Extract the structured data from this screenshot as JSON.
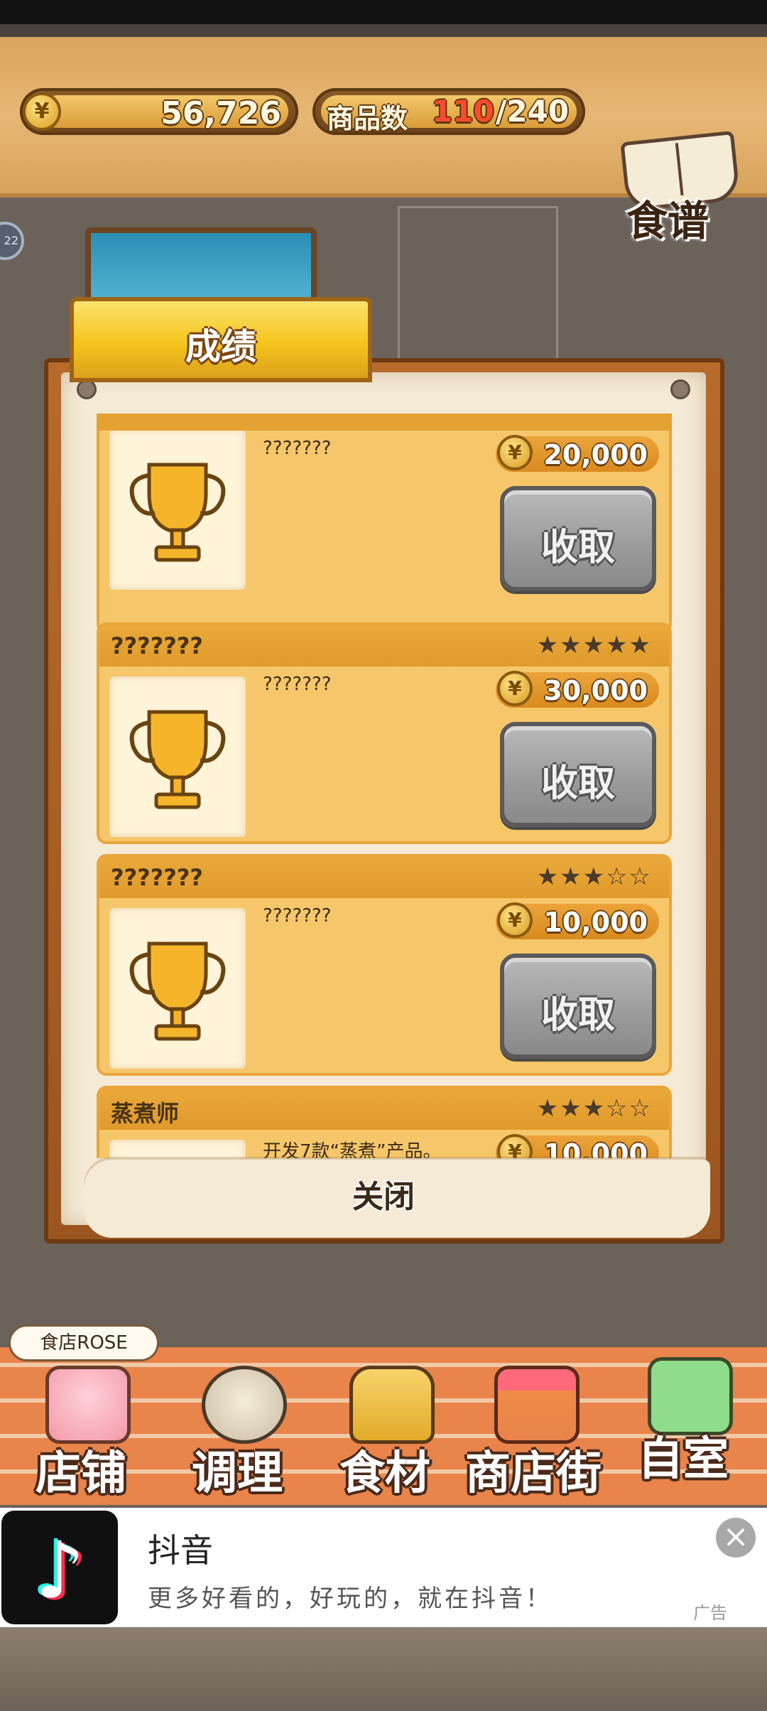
{
  "header": {
    "coins": "56,726",
    "goods_label": "商品数",
    "goods_count": "110",
    "goods_total": "/240",
    "recipe_label": "食谱",
    "badge_text": "22"
  },
  "panel": {
    "tab_label": "成绩",
    "close_label": "关闭",
    "collect_label": "收取",
    "cards": [
      {
        "title": "???????",
        "stars": "★★★★☆",
        "desc": "???????",
        "reward": "20,000"
      },
      {
        "title": "???????",
        "stars": "★★★★★",
        "desc": "???????",
        "reward": "30,000"
      },
      {
        "title": "???????",
        "stars": "★★★☆☆",
        "desc": "???????",
        "reward": "10,000"
      },
      {
        "title": "蒸煮师",
        "stars": "★★★☆☆",
        "desc": "开发7款“蒸煮”产品。",
        "reward": "10,000"
      }
    ]
  },
  "shop_name": "食店ROSE",
  "nav": [
    {
      "label": "店铺",
      "icon": "cake-icon"
    },
    {
      "label": "调理",
      "icon": "mixing-bowl-icon"
    },
    {
      "label": "食材",
      "icon": "flour-bag-icon"
    },
    {
      "label": "商店街",
      "icon": "store-icon"
    },
    {
      "label": "自室",
      "icon": "staff-only-sign-icon"
    }
  ],
  "ad": {
    "title": "抖音",
    "desc": "更多好看的，好玩的，就在抖音！",
    "tag": "广告",
    "close": "×",
    "logo": "♪"
  },
  "colors": {
    "accent": "#f6c41d",
    "button_gray": "#9a9a9a",
    "brick": "#e9844a"
  }
}
